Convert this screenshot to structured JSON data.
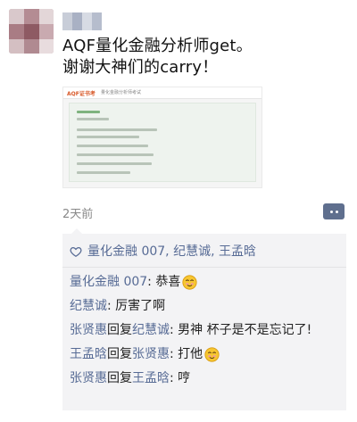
{
  "post": {
    "text_line1": "AQF量化金融分析师get。",
    "text_line2": "谢谢大神们的carry！",
    "time": "2天前"
  },
  "shared_card": {
    "brand": "AQF证书考",
    "tag": "量化金融分析师考试"
  },
  "likes": {
    "names": "量化金融 007, 纪慧诚, 王孟晗"
  },
  "comments": [
    {
      "from": "量化金融 007",
      "to": "",
      "reply_word": "",
      "text": ": 恭喜",
      "emoji": "smile-emoji"
    },
    {
      "from": "纪慧诚",
      "to": "",
      "reply_word": "",
      "text": ": 厉害了啊",
      "emoji": ""
    },
    {
      "from": "张贤惠",
      "to": "纪慧诚",
      "reply_word": "回复",
      "text": ": 男神 杯子是不是忘记了!",
      "emoji": ""
    },
    {
      "from": "王孟晗",
      "to": "张贤惠",
      "reply_word": "回复",
      "text": ": 打他",
      "emoji": "smile-emoji"
    },
    {
      "from": "张贤惠",
      "to": "王孟晗",
      "reply_word": "回复",
      "text": ": 哼",
      "emoji": ""
    }
  ],
  "colors": {
    "link": "#576b95",
    "panel_bg": "#f3f3f5",
    "more_button": "#5f6f8e"
  }
}
